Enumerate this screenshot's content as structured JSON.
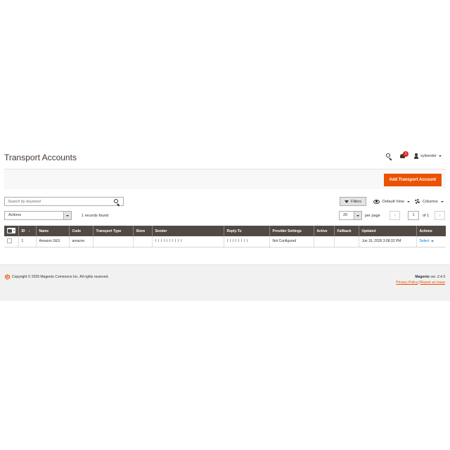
{
  "page": {
    "title": "Transport Accounts"
  },
  "header": {
    "notification_count": "1",
    "username": "sylwester"
  },
  "action_bar": {
    "add_button_label": "Add Transport Account"
  },
  "toolbar": {
    "search_placeholder": "Search by keyword",
    "filters_label": "Filters",
    "view_label": "Default View",
    "columns_label": "Columns",
    "mass_action_label": "Actions",
    "records_found": "1 records found",
    "per_page_value": "20",
    "per_page_label": "per page",
    "current_page": "1",
    "page_total": "of 1",
    "prev_glyph": "‹",
    "next_glyph": "›"
  },
  "grid": {
    "columns": [
      "ID",
      "Name",
      "Code",
      "Transport Type",
      "Store",
      "Sender",
      "Reply-To",
      "Provider Settings",
      "Active",
      "Fallback",
      "Updated",
      "Actions"
    ],
    "sort_indicator": "↓",
    "rows": [
      {
        "id": "1",
        "name": "Amazon SES",
        "code": "amazon",
        "transport_type": "",
        "store": "",
        "sender": "",
        "reply_to": "",
        "provider_settings": "Not Configured",
        "active": "",
        "fallback": "",
        "updated": "Jun 16, 2026 3:08:32 PM",
        "action": "Select"
      }
    ]
  },
  "footer": {
    "copyright": "Copyright © 2026 Magento Commerce Inc. All rights reserved.",
    "brand": "Magento",
    "version": "ver. 2.4.9",
    "privacy_link": "Privacy Policy",
    "separator": "|",
    "report_link": "Report an Issue"
  },
  "colors": {
    "accent": "#eb5202",
    "grid_header": "#514943",
    "link": "#007bdb",
    "badge": "#e22626"
  }
}
